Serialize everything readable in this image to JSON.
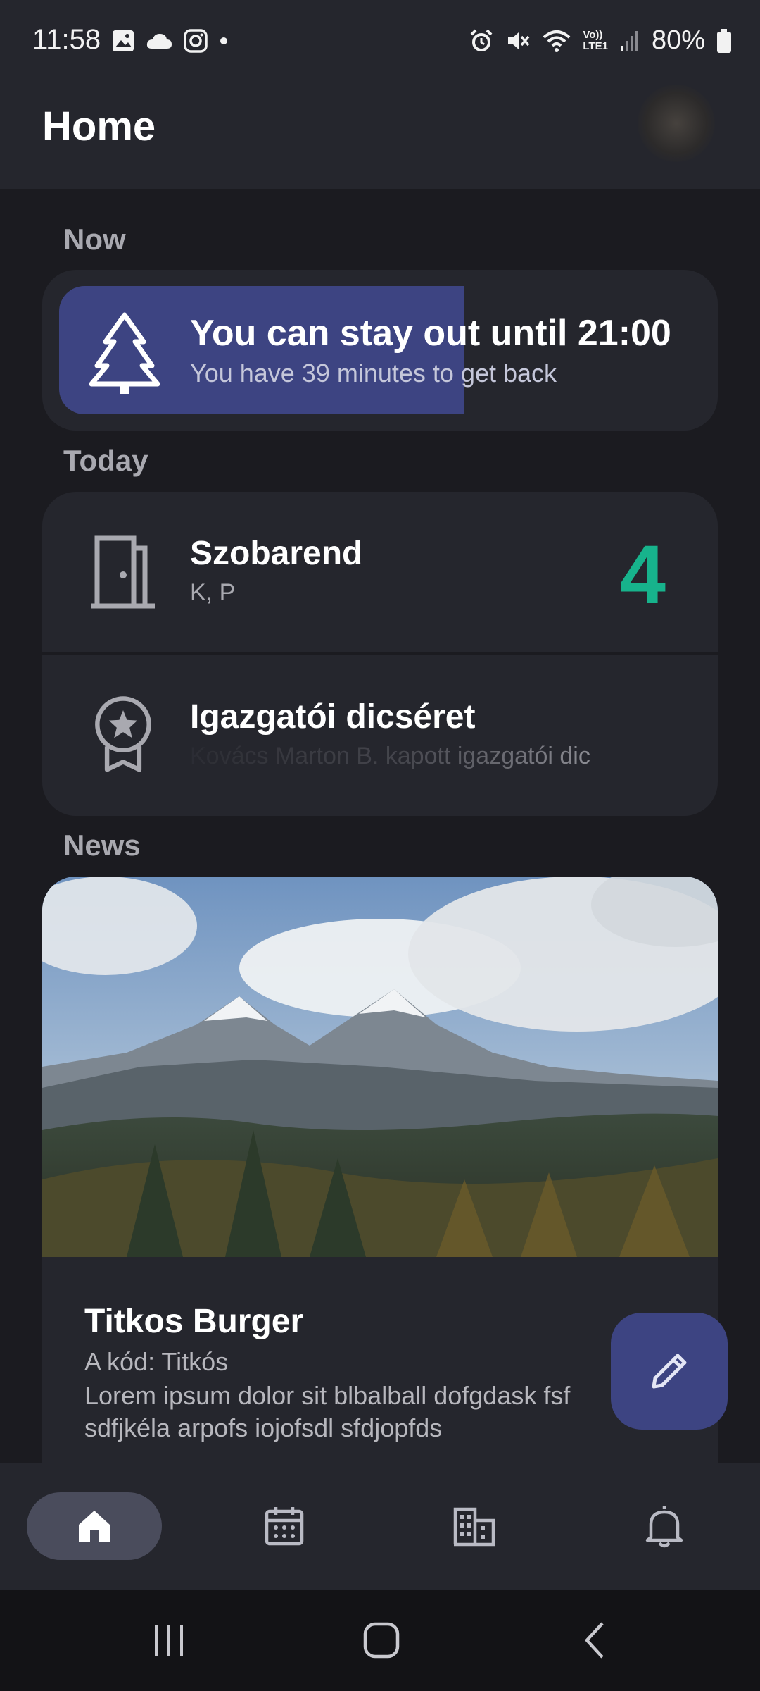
{
  "status_bar": {
    "time": "11:58",
    "battery": "80%",
    "left_icons": [
      "gallery-icon",
      "cloud-icon",
      "instagram-icon",
      "dot-icon"
    ],
    "right_icons": [
      "alarm-icon",
      "mute-icon",
      "wifi-icon",
      "lte-icon",
      "signal-icon",
      "battery-icon"
    ],
    "lte_label_top": "Vo))",
    "lte_label_bottom": "LTE1"
  },
  "app_bar": {
    "title": "Home"
  },
  "sections": {
    "now": "Now",
    "today": "Today",
    "news": "News"
  },
  "now_card": {
    "title": "You can stay out until 21:00",
    "subtitle": "You have 39 minutes to get back",
    "progress_fraction": 0.63,
    "icon": "tree-icon",
    "accent": "#3d4482"
  },
  "today": {
    "items": [
      {
        "title": "Szobarend",
        "subtitle": "K, P",
        "count": "4",
        "icon": "door-icon",
        "count_color": "#17b38c"
      },
      {
        "title": "Igazgatói dicséret",
        "subtitle": "Kovács Marton B. kapott igazgatói dic",
        "icon": "award-icon"
      }
    ]
  },
  "news": {
    "title": "Titkos Burger",
    "subtitle": "A kód: Titkós",
    "body": "Lorem ipsum dolor sit blbalball dofgdask fsf sdfjkéla arpofs iojofsdl sfdjopfds",
    "image": "mountain-photo"
  },
  "fab": {
    "icon": "edit-icon"
  },
  "bottom_nav": {
    "items": [
      {
        "icon": "home-icon",
        "active": true
      },
      {
        "icon": "calendar-icon",
        "active": false
      },
      {
        "icon": "building-icon",
        "active": false
      },
      {
        "icon": "bell-icon",
        "active": false
      }
    ]
  },
  "system_nav": {
    "items": [
      "recents-button",
      "home-button",
      "back-button"
    ]
  }
}
